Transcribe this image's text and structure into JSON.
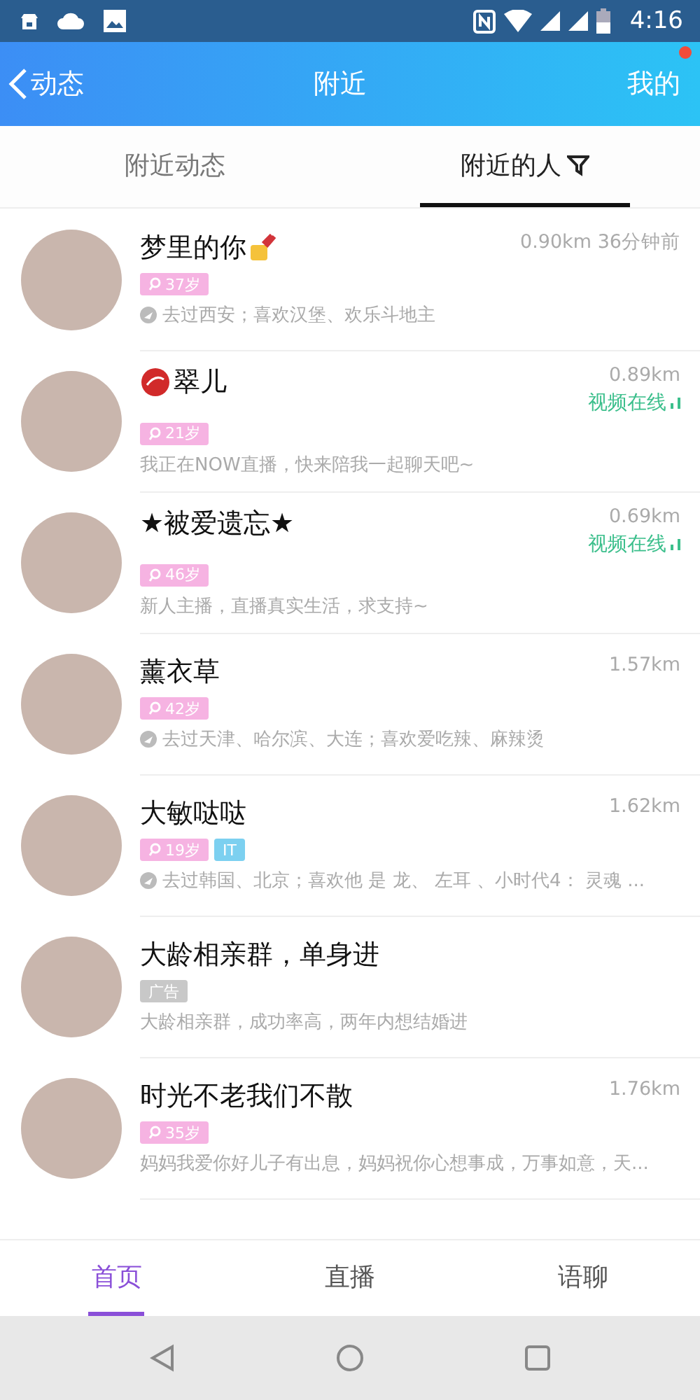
{
  "status_bar": {
    "time": "4:16"
  },
  "header": {
    "back": "动态",
    "title": "附近",
    "profile": "我的",
    "profile_dot": true
  },
  "tabs": [
    {
      "label": "附近动态",
      "selected": false,
      "filter": false
    },
    {
      "label": "附近的人",
      "selected": true,
      "filter": true
    }
  ],
  "people": [
    {
      "name": "梦里的你",
      "name_icon": {
        "kind": "nails"
      },
      "meta": "0.90km 36分钟前",
      "badges": [
        {
          "kind": "age",
          "text": "37岁"
        }
      ],
      "note": "去过西安；喜欢汉堡、欢乐斗地主",
      "note_icon": true
    },
    {
      "name": "翠儿",
      "name_icon": {
        "kind": "lips"
      },
      "meta": "0.89km",
      "status": "视频在线",
      "badges": [
        {
          "kind": "age",
          "text": "21岁"
        }
      ],
      "note": "我正在NOW直播，快来陪我一起聊天吧~",
      "note_icon": false
    },
    {
      "name": "★被爱遗忘★",
      "meta": "0.69km",
      "status": "视频在线",
      "badges": [
        {
          "kind": "age",
          "text": "46岁"
        }
      ],
      "note": "新人主播，直播真实生活，求支持~",
      "note_icon": false
    },
    {
      "name": "薰衣草",
      "meta": "1.57km",
      "badges": [
        {
          "kind": "age",
          "text": "42岁"
        }
      ],
      "note": "去过天津、哈尔滨、大连；喜欢爱吃辣、麻辣烫",
      "note_icon": true
    },
    {
      "name": "大敏哒哒",
      "meta": "1.62km",
      "badges": [
        {
          "kind": "age",
          "text": "19岁"
        },
        {
          "kind": "tag",
          "text": "IT"
        }
      ],
      "note": "去过韩国、北京；喜欢他 是 龙、 左耳 、小时代4： 灵魂 ...",
      "note_icon": true
    },
    {
      "name": "大龄相亲群，单身进",
      "badges": [
        {
          "kind": "ad",
          "text": "广告"
        }
      ],
      "note": "大龄相亲群，成功率高，两年内想结婚进",
      "note_icon": false
    },
    {
      "name": "时光不老我们不散",
      "meta": "1.76km",
      "badges": [
        {
          "kind": "age",
          "text": "35岁"
        }
      ],
      "note": "妈妈我爱你好儿子有出息，妈妈祝你心想事成，万事如意，天...",
      "note_icon": false
    }
  ],
  "bottom_nav": [
    {
      "label": "首页",
      "selected": true
    },
    {
      "label": "直播",
      "selected": false
    },
    {
      "label": "语聊",
      "selected": false
    }
  ]
}
